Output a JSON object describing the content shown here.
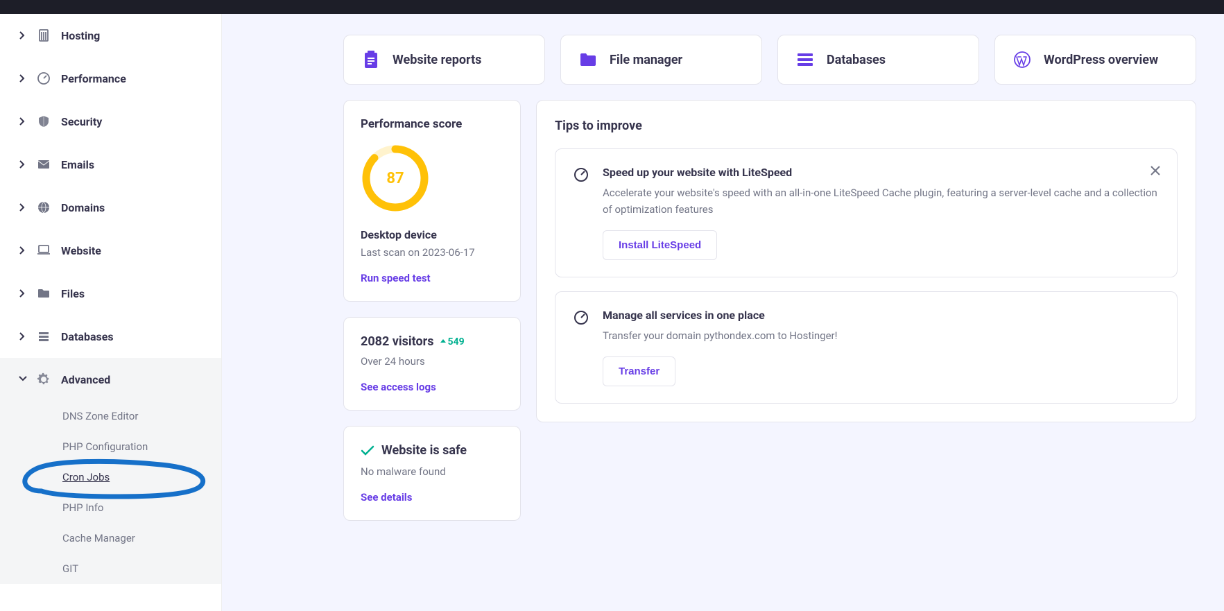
{
  "colors": {
    "accent": "#673de6",
    "score": "#ffc107",
    "delta": "#00b090"
  },
  "sidebar": {
    "items": [
      {
        "label": "Hosting"
      },
      {
        "label": "Performance"
      },
      {
        "label": "Security"
      },
      {
        "label": "Emails"
      },
      {
        "label": "Domains"
      },
      {
        "label": "Website"
      },
      {
        "label": "Files"
      },
      {
        "label": "Databases"
      },
      {
        "label": "Advanced"
      }
    ],
    "advanced_sub": [
      {
        "label": "DNS Zone Editor"
      },
      {
        "label": "PHP Configuration"
      },
      {
        "label": "Cron Jobs"
      },
      {
        "label": "PHP Info"
      },
      {
        "label": "Cache Manager"
      },
      {
        "label": "GIT"
      }
    ]
  },
  "quick": [
    {
      "label": "Website reports"
    },
    {
      "label": "File manager"
    },
    {
      "label": "Databases"
    },
    {
      "label": "WordPress overview"
    }
  ],
  "perf": {
    "title": "Performance score",
    "score": "87",
    "device": "Desktop device",
    "last_scan": "Last scan on 2023-06-17",
    "run": "Run speed test"
  },
  "visitors": {
    "count": "2082 visitors",
    "delta": "549",
    "period": "Over 24 hours",
    "link": "See access logs"
  },
  "safety": {
    "title": "Website is safe",
    "sub": "No malware found",
    "link": "See details"
  },
  "tips": {
    "heading": "Tips to improve",
    "items": [
      {
        "title": "Speed up your website with LiteSpeed",
        "desc": "Accelerate your website's speed with an all-in-one LiteSpeed Cache plugin, featuring a server-level cache and a collection of optimization features",
        "button": "Install LiteSpeed",
        "closable": true
      },
      {
        "title": "Manage all services in one place",
        "desc": "Transfer your domain pythondex.com to Hostinger!",
        "button": "Transfer",
        "closable": false
      }
    ]
  }
}
